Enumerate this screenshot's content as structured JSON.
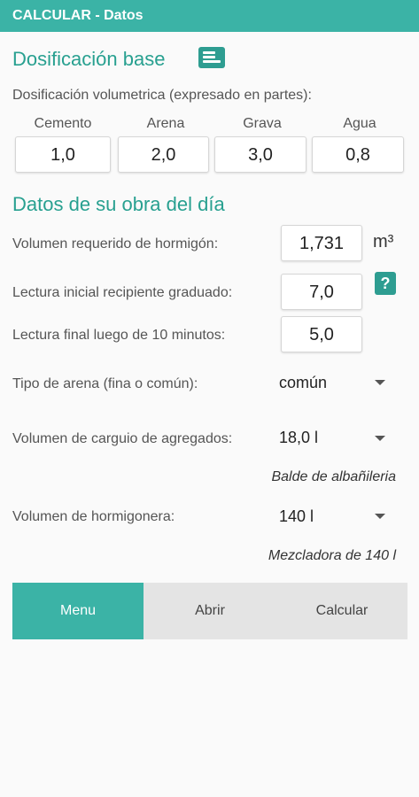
{
  "app": {
    "title": "CALCULAR - Datos"
  },
  "dosificacion": {
    "title": "Dosificación base",
    "subtitle": "Dosificación volumetrica (expresado en partes):",
    "columns": [
      {
        "label": "Cemento",
        "value": "1,0"
      },
      {
        "label": "Arena",
        "value": "2,0"
      },
      {
        "label": "Grava",
        "value": "3,0"
      },
      {
        "label": "Agua",
        "value": "0,8"
      }
    ]
  },
  "obra": {
    "title": "Datos de su obra del día",
    "volumen_label": "Volumen requerido de hormigón:",
    "volumen_value": "1,731",
    "volumen_unit": "m³",
    "lectura_inicial_label": "Lectura inicial recipiente graduado:",
    "lectura_inicial_value": "7,0",
    "lectura_final_label": "Lectura final luego de 10 minutos:",
    "lectura_final_value": "5,0",
    "help_icon": "?",
    "tipo_arena_label": "Tipo de arena (fina o común):",
    "tipo_arena_value": "común",
    "carguio_label": "Volumen de carguio de agregados:",
    "carguio_value": "18,0 l",
    "carguio_hint": "Balde de albañileria",
    "hormigonera_label": "Volumen de hormigonera:",
    "hormigonera_value": "140 l",
    "hormigonera_hint": "Mezcladora de 140 l"
  },
  "tabs": [
    {
      "label": "Menu",
      "active": true
    },
    {
      "label": "Abrir",
      "active": false
    },
    {
      "label": "Calcular",
      "active": false
    }
  ],
  "colors": {
    "accent": "#3bb3a6",
    "title": "#28a090"
  },
  "icons": {
    "doc": "document-icon",
    "help": "help-icon",
    "caret": "dropdown-arrow-icon"
  }
}
